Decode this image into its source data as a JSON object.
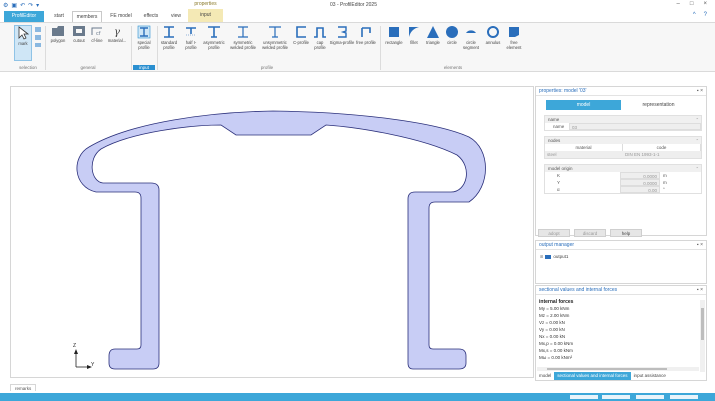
{
  "titlebar": {
    "title": "03 - ProfilEditor 2025",
    "qat_icons": [
      "app-logo-icon",
      "save-icon",
      "undo-icon",
      "redo-icon",
      "qat-dropdown-icon"
    ],
    "win_min": "–",
    "win_max": "□",
    "win_close": "×"
  },
  "tabs": {
    "file": "ProfilEditor",
    "start": "start",
    "members": "members",
    "fe_model": "FE model",
    "effects": "effects",
    "view": "view",
    "input": "input",
    "contextual_group": "properties"
  },
  "help": {
    "collapse": "^",
    "help": "?"
  },
  "ribbon": {
    "selection": {
      "mark": "mark",
      "label": "selection"
    },
    "general": {
      "polygon": "polygon",
      "cutout": "cutout",
      "cfthin": "cf-line",
      "material": "material...",
      "label": "general"
    },
    "input_group": {
      "special_profile": "special profile",
      "label": "input"
    },
    "profile": {
      "standard": "standard profile",
      "half": "half I-profile",
      "asymmetric": "asymmetric profile",
      "asym_welded": "symmetric welded profile",
      "unsym_welded": "unsymmetric welded profile",
      "c_profile": "C-profile",
      "cap": "cap profile",
      "sigma": "Sigma-profile",
      "free": "free profile",
      "label": "profile"
    },
    "elements": {
      "rectangle": "rectangle",
      "fillet": "fillet",
      "triangle": "triangle",
      "circle": "circle",
      "circle_segment": "circle segment",
      "annulus": "annulus",
      "free_element": "free element",
      "label": "elements"
    }
  },
  "canvas": {
    "axis_z": "Z",
    "axis_y": "Y"
  },
  "properties": {
    "title": "properties: model '03'",
    "tab_model": "model",
    "tab_representation": "representation",
    "name_section": "name",
    "name_label": "name",
    "name_value": "03",
    "nodes_section": "nodes",
    "material_header": "material",
    "code_header": "code",
    "material_value": "steel",
    "code_value": "DIN EN 1993-1-1",
    "origin_section": "model origin",
    "origin": [
      {
        "k": "K",
        "v": "0.0000",
        "u": "m"
      },
      {
        "k": "Y",
        "v": "0.0000",
        "u": "m"
      },
      {
        "k": "α",
        "v": "0.00",
        "u": "°"
      }
    ],
    "btn_adopt": "adopt",
    "btn_discard": "discard",
    "btn_help": "help"
  },
  "output_manager": {
    "title": "output manager",
    "item": "output1"
  },
  "sectional": {
    "title": "sectional values and internal forces",
    "heading": "internal forces",
    "rows": [
      "My    = 5.00 kNm",
      "Mz    = 2.00 kNm",
      "Vz    = 0.00 kN",
      "Vy    = 0.00 kN",
      "Nx    = 0.00 kN",
      "Mx,p = 0.00 kNm",
      "Mx,s = 0.00 kNm",
      "Mω   = 0.00 kNm²"
    ],
    "tab_model": "model",
    "tab_sectional": "sectional values and internal forces",
    "tab_input": "input assistance"
  },
  "bottom": {
    "remarks": "remarks"
  },
  "colors": {
    "accent": "#3da7d9",
    "profile_fill": "#c8cdf5",
    "profile_stroke": "#2a2f7a"
  }
}
